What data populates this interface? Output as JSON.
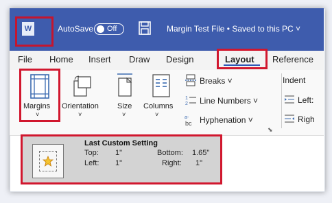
{
  "titlebar": {
    "app_icon": "W",
    "autosave_label": "AutoSave",
    "toggle_state": "Off",
    "file_title": "Margin Test File • Saved to this PC ˅"
  },
  "menu_tabs": [
    "File",
    "Home",
    "Insert",
    "Draw",
    "Design",
    "Layout",
    "Reference"
  ],
  "ribbon": {
    "margins": "Margins",
    "orientation": "Orientation",
    "size": "Size",
    "columns": "Columns",
    "breaks": "Breaks ˅",
    "line_numbers": "Line Numbers ˅",
    "hyphenation": "Hyphenation ˅",
    "indent": "Indent",
    "indent_left": "Left:",
    "indent_right": "Righ"
  },
  "margin_setting": {
    "title": "Last Custom Setting",
    "top_label": "Top:",
    "top_value": "1\"",
    "bottom_label": "Bottom:",
    "bottom_value": "1.65\"",
    "left_label": "Left:",
    "left_value": "1\"",
    "right_label": "Right:",
    "right_value": "1\""
  },
  "colors": {
    "titlebar_bg": "#3e5cad",
    "highlight_red": "#d1172e",
    "layout_underline": "#2d57b6"
  }
}
